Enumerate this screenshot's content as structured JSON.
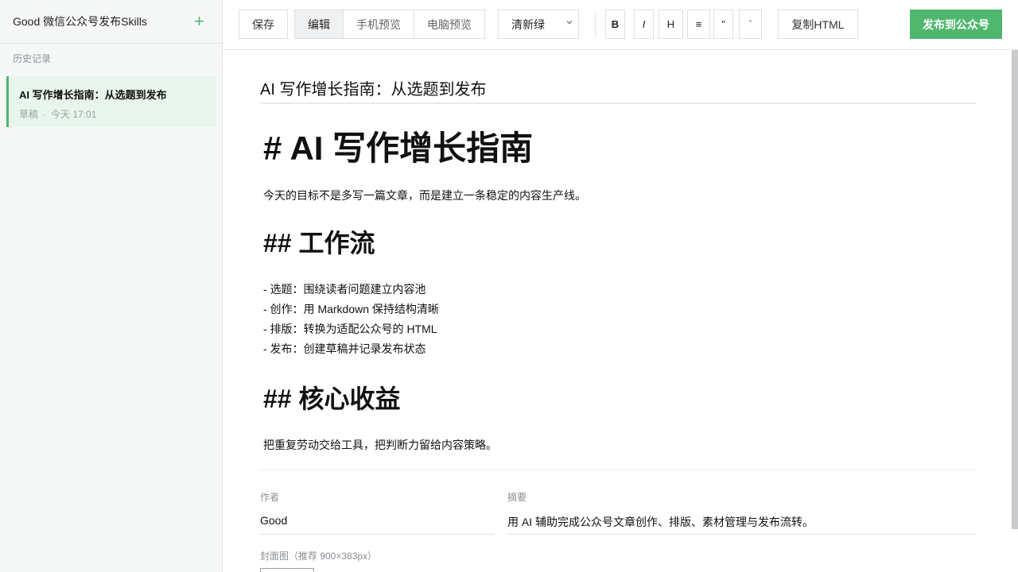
{
  "app": {
    "title": "Good 微信公众号发布Skills",
    "add_icon": "+"
  },
  "sidebar": {
    "section_label": "历史记录",
    "items": [
      {
        "title": "AI 写作增长指南：从选题到发布",
        "status": "草稿",
        "separator": "·",
        "time": "今天 17:01"
      }
    ]
  },
  "toolbar": {
    "save_label": "保存",
    "modes": [
      "编辑",
      "手机预览",
      "电脑预览"
    ],
    "active_mode": "编辑",
    "theme_value": "清新绿",
    "format_buttons": [
      "B",
      "I",
      "H",
      "≡",
      "\"",
      "`"
    ],
    "copy_html_label": "复制HTML",
    "publish_label": "发布到公众号"
  },
  "editor": {
    "title": "AI 写作增长指南：从选题到发布",
    "h1": "# AI 写作增长指南",
    "intro": "今天的目标不是多写一篇文章，而是建立一条稳定的内容生产线。",
    "h2_workflow": "## 工作流",
    "workflow_items": [
      "- 选题：围绕读者问题建立内容池",
      "- 创作：用 Markdown 保持结构清晰",
      "- 排版：转换为适配公众号的 HTML",
      "- 发布：创建草稿并记录发布状态"
    ],
    "h2_benefit": "## 核心收益",
    "benefit": "把重复劳动交给工具，把判断力留给内容策略。"
  },
  "meta": {
    "author_label": "作者",
    "author_value": "Good",
    "summary_label": "摘要",
    "summary_value": "用 AI 辅助完成公众号文章创作、排版、素材管理与发布流转。",
    "cover_label": "封面图（推荐 900×383px）"
  },
  "colors": {
    "accent": "#4fb76e",
    "accent_light": "#e8f5ec"
  }
}
